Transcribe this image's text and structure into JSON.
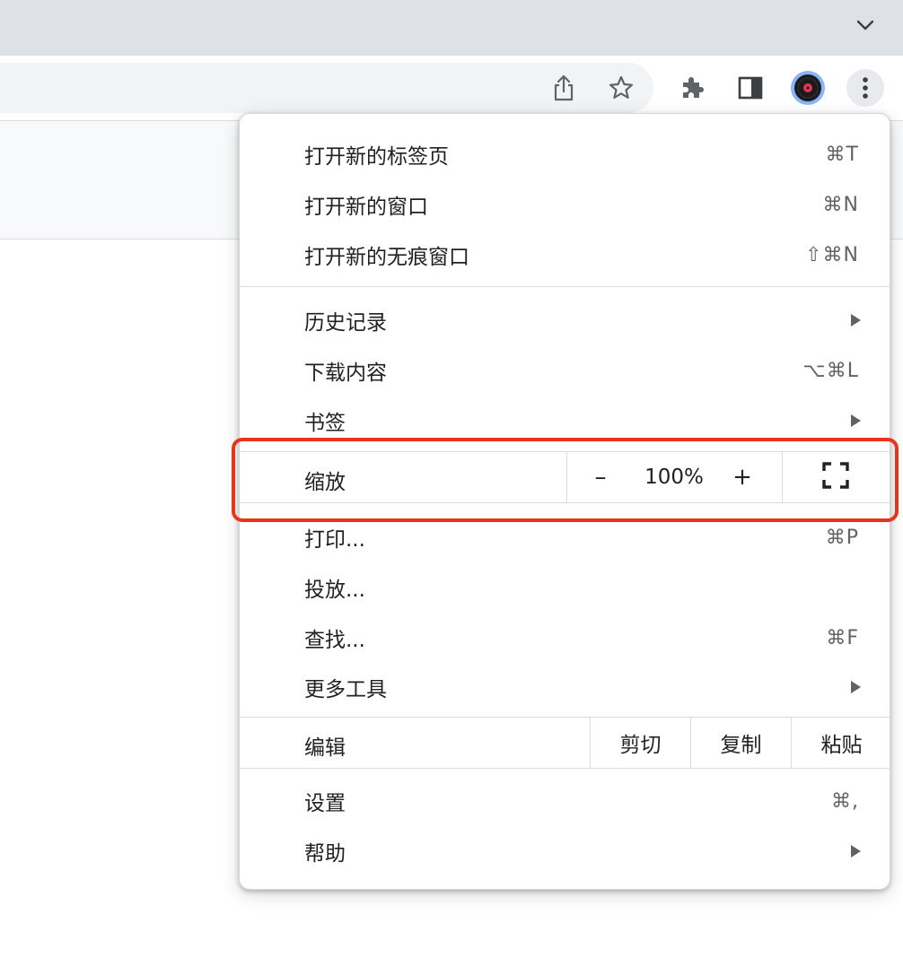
{
  "browser": {
    "icons": {
      "tab_search": "chevron-down-icon",
      "share": "share-icon",
      "bookmark": "star-icon",
      "extensions": "puzzle-icon",
      "side_panel": "side-panel-icon",
      "profile": "profile-avatar",
      "menu": "vertical-dots-icon"
    },
    "colors": {
      "tabstrip": "#dee1e6",
      "omnibox": "#f1f3f4",
      "menu_button_active": "#e8eaed",
      "highlight_outline": "#e8341c"
    }
  },
  "menu": {
    "items": [
      {
        "label": "打开新的标签页",
        "shortcut": "⌘T"
      },
      {
        "label": "打开新的窗口",
        "shortcut": "⌘N"
      },
      {
        "label": "打开新的无痕窗口",
        "shortcut": "⇧⌘N"
      },
      {
        "label": "历史记录",
        "has_submenu": true
      },
      {
        "label": "下载内容",
        "shortcut": "⌥⌘L"
      },
      {
        "label": "书签",
        "has_submenu": true
      }
    ],
    "zoom": {
      "label": "缩放",
      "decrease": "–",
      "value": "100%",
      "increase": "+",
      "fullscreen_icon": "fullscreen-icon"
    },
    "items2": [
      {
        "label": "打印...",
        "shortcut": "⌘P"
      },
      {
        "label": "投放..."
      },
      {
        "label": "查找...",
        "shortcut": "⌘F"
      },
      {
        "label": "更多工具",
        "has_submenu": true
      }
    ],
    "edit": {
      "label": "编辑",
      "cut": "剪切",
      "copy": "复制",
      "paste": "粘贴"
    },
    "items3": [
      {
        "label": "设置",
        "shortcut": "⌘,"
      },
      {
        "label": "帮助",
        "has_submenu": true
      }
    ]
  }
}
